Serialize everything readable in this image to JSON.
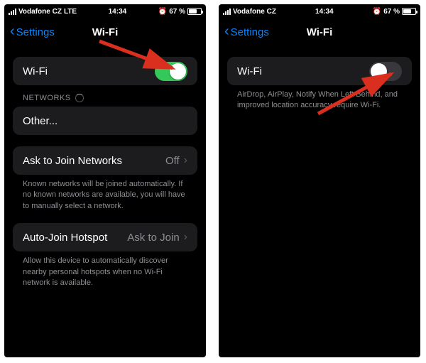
{
  "status": {
    "carrier": "Vodafone CZ",
    "network": "LTE",
    "time": "14:34",
    "alarm_glyph": "⏰",
    "battery_text": "67 %"
  },
  "nav": {
    "back_label": "Settings",
    "title": "Wi-Fi"
  },
  "left_screen": {
    "wifi_row_label": "Wi-Fi",
    "networks_header": "NETWORKS",
    "other_label": "Other...",
    "ask_join_label": "Ask to Join Networks",
    "ask_join_value": "Off",
    "ask_join_footer": "Known networks will be joined automatically. If no known networks are available, you will have to manually select a network.",
    "auto_join_label": "Auto-Join Hotspot",
    "auto_join_value": "Ask to Join",
    "auto_join_footer": "Allow this device to automatically discover nearby personal hotspots when no Wi-Fi network is available."
  },
  "right_screen": {
    "wifi_row_label": "Wi-Fi",
    "wifi_off_footer": "AirDrop, AirPlay, Notify When Left Behind, and improved location accuracy require Wi-Fi."
  },
  "colors": {
    "accent_blue": "#0a84ff",
    "toggle_green": "#34c759",
    "arrow_red": "#da2f1f"
  }
}
